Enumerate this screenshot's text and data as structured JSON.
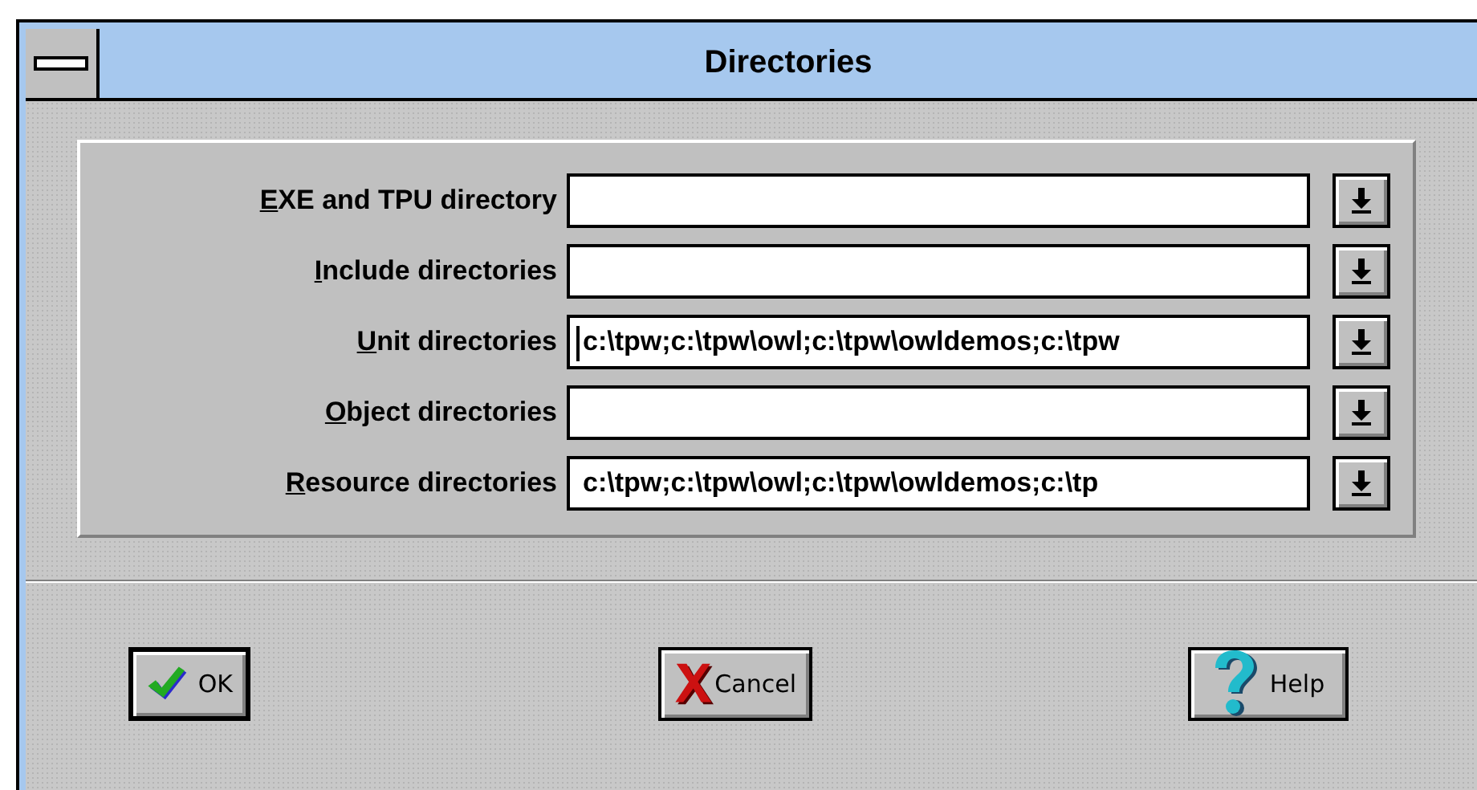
{
  "window": {
    "title": "Directories"
  },
  "fields": [
    {
      "label": "EXE and TPU directory",
      "focused": false
    },
    {
      "label": "Include directories",
      "focused": false
    },
    {
      "label": "Unit directories",
      "value": "c:\\tpw;c:\\tpw\\owl;c:\\tpw\\owldemos;c:\\tpw",
      "focused": true
    },
    {
      "label": "Object directories",
      "focused": false
    },
    {
      "label": "Resource directories",
      "value": "c:\\tpw;c:\\tpw\\owl;c:\\tpw\\owldemos;c:\\tp",
      "focused": false
    }
  ],
  "buttons": [
    {
      "label": "OK",
      "kind": "ok",
      "default": true
    },
    {
      "label": "Cancel",
      "kind": "cancel",
      "default": false
    },
    {
      "label": "Help",
      "kind": "help",
      "default": false
    }
  ]
}
